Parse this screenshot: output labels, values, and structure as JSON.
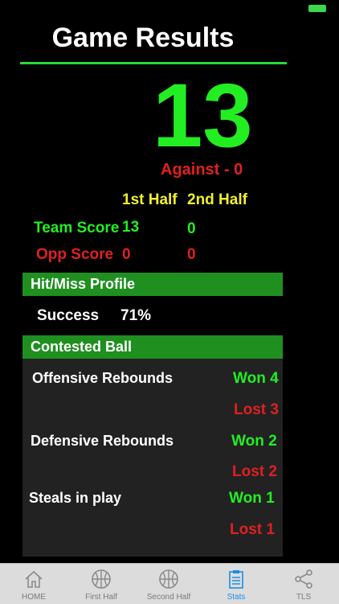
{
  "title": "Game Results",
  "score": {
    "total": "13",
    "against": "Against - 0"
  },
  "halves": {
    "headers": [
      "1st Half",
      "2nd Half"
    ],
    "team_label": "Team Score",
    "team_values": [
      "13",
      "0"
    ],
    "opp_label": "Opp Score",
    "opp_values": [
      "0",
      "0"
    ]
  },
  "hit_miss": {
    "header": "Hit/Miss Profile",
    "label": "Success",
    "value": "71%"
  },
  "contested": {
    "header": "Contested Ball",
    "items": [
      {
        "label": "Offensive Rebounds",
        "won": "Won 4",
        "lost": "Lost 3"
      },
      {
        "label": "Defensive Rebounds",
        "won": "Won 2",
        "lost": "Lost 2"
      },
      {
        "label": "Steals in play",
        "won": "Won 1",
        "lost": "Lost 1"
      }
    ]
  },
  "tabs": [
    {
      "label": "HOME",
      "icon": "home-icon"
    },
    {
      "label": "First Half",
      "icon": "basketball-icon"
    },
    {
      "label": "Second Half",
      "icon": "basketball-icon"
    },
    {
      "label": "Stats",
      "icon": "clipboard-icon"
    },
    {
      "label": "TLS",
      "icon": "share-icon"
    }
  ],
  "colors": {
    "accent_green": "#22ee22",
    "loss_red": "#e02020",
    "header_yellow": "#f0f030",
    "section_green": "#1f8f1f",
    "active_tab_blue": "#1a8fe3"
  }
}
